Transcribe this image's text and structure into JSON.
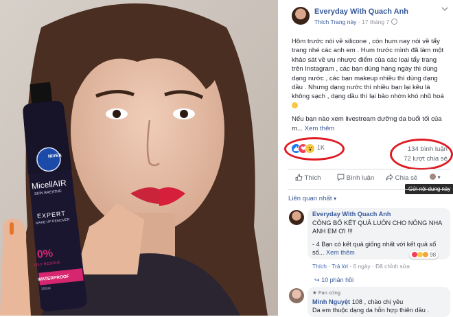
{
  "post": {
    "author": "Everyday With Quach Anh",
    "like_page": "Thích Trang này",
    "dot": "·",
    "date": "17 tháng 7",
    "body_p1": "Hôm trước nói về silicone , còn hum nay nói về tẩy trang nhé các anh em . Hum trước mình đã làm một khảo sát về ưu nhược điểm của các loại tẩy trang trên Instagram , các bạn dùng hàng ngày thì dùng dạng nước , các bạn makeup nhiều thì dùng dạng dầu . Nhưng dạng nước thì nhiều bạn lại kêu là không sạch , dạng dầu thì lại bảo nhờn khó nhũ hoá",
    "body_p2": "Nếu bạn nào xem livestream dưỡng da buổi tối của m...",
    "see_more": "Xem thêm",
    "reaction_count": "1K",
    "comments_count": "134 bình luận",
    "shares_count": "72 lượt chia sẻ"
  },
  "actions": {
    "like": "Thích",
    "comment": "Bình luận",
    "share": "Chia sẻ",
    "tooltip": "Gửi nội dung này"
  },
  "related": "Liên quan nhất",
  "comments": [
    {
      "name": "Everyday With Quach Anh",
      "text": "CÔNG BỐ KẾT QUẢ LUÔN CHO NÔNG NHA ANH EM ƠI !!!",
      "text2": "- 4 Bạn có kết quả giống nhất với kết quả xổ số...",
      "see_more": "Xem thêm",
      "like": "Thích",
      "reply": "Trả lời",
      "time": "6 ngày",
      "edited": "Đã chỉnh sửa",
      "reaction_count": "98",
      "replies": "10 phản hồi"
    },
    {
      "badge": "Fan cứng",
      "name": "Minh Nguyệt",
      "text": "108 , chào chị yêu",
      "text2": "Da em thuộc dạng da hỗn hợp thiên dầu ."
    }
  ],
  "product": {
    "brand": "NIVEA",
    "line1": "MicellAIR",
    "line2": "SKIN BREATHE",
    "line3": "EXPERT",
    "line4": "MAKE-UP REMOVER",
    "pct": "0%",
    "pct_sub": "OILY RESIDUE",
    "waterproof": "WATERPROOF",
    "vol": "200ml"
  },
  "colors": {
    "link": "#365899",
    "accent_ring": "#e01a22",
    "like_blue": "#1877f2",
    "heart_red": "#f33e58",
    "bottle_pink": "#d6266f"
  }
}
